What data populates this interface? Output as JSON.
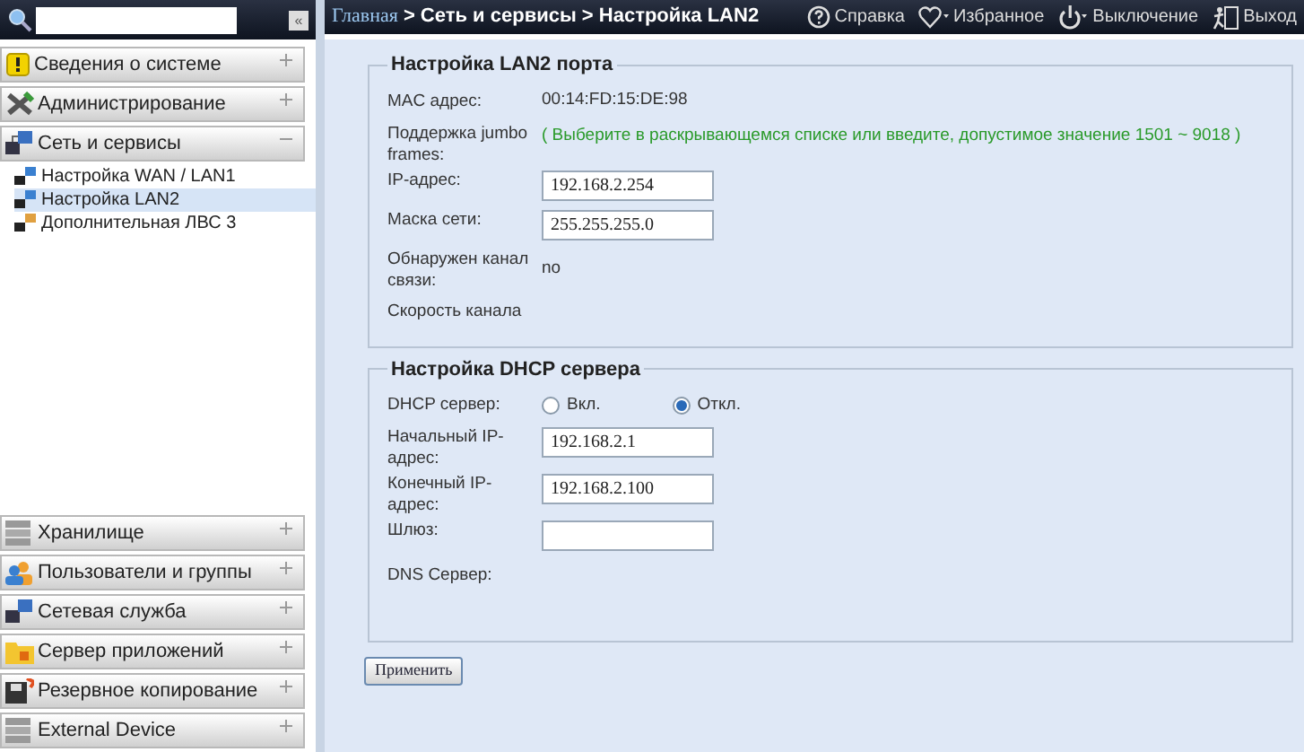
{
  "sidebar": {
    "collapse_label": "«",
    "groups_top": [
      {
        "label": "Сведения о системе",
        "expanded": false
      },
      {
        "label": "Администрирование",
        "expanded": false
      },
      {
        "label": "Сеть и сервисы",
        "expanded": true,
        "children": [
          {
            "label": "Настройка WAN / LAN1",
            "selected": false
          },
          {
            "label": "Настройка LAN2",
            "selected": true
          },
          {
            "label": "Дополнительная ЛВС 3",
            "selected": false
          }
        ]
      }
    ],
    "groups_bottom": [
      {
        "label": "Хранилище",
        "expanded": false
      },
      {
        "label": "Пользователи и группы",
        "expanded": false
      },
      {
        "label": "Сетевая служба",
        "expanded": false
      },
      {
        "label": "Сервер приложений",
        "expanded": false
      },
      {
        "label": "Резервное копирование",
        "expanded": false
      },
      {
        "label": "External Device",
        "expanded": false
      }
    ]
  },
  "header": {
    "breadcrumb_home": "Главная",
    "breadcrumb_rest": "> Сеть и сервисы > Настройка LAN2",
    "actions": [
      {
        "label": "Справка",
        "kind": "help"
      },
      {
        "label": "Избранное",
        "kind": "favorite"
      },
      {
        "label": "Выключение",
        "kind": "power"
      },
      {
        "label": "Выход",
        "kind": "logout"
      }
    ]
  },
  "lan_section": {
    "title": "Настройка LAN2 порта",
    "rows": [
      {
        "kind": "text",
        "label": "MAC адрес:",
        "value": "00:14:FD:15:DE:98"
      },
      {
        "kind": "hint",
        "label": "Поддержка jumbo frames:",
        "value": "( Выберите в раскрывающемся списке или введите, допустимое значение 1501 ~ 9018 )"
      },
      {
        "kind": "input",
        "label": "IP-адрес:",
        "value": "192.168.2.254"
      },
      {
        "kind": "input",
        "label": "Маска сети:",
        "value": "255.255.255.0"
      },
      {
        "kind": "text",
        "label": "Обнаружен канал связи:",
        "value": "no"
      },
      {
        "kind": "label",
        "label": "Скорость канала"
      }
    ]
  },
  "dhcp_section": {
    "title": "Настройка DHCP сервера",
    "rows": [
      {
        "kind": "radio",
        "label": "DHCP сервер:",
        "options": [
          {
            "label": "Вкл.",
            "selected": false
          },
          {
            "label": "Откл.",
            "selected": true
          }
        ]
      },
      {
        "kind": "input",
        "label": "Начальный IP-адрес:",
        "value": "192.168.2.1"
      },
      {
        "kind": "input",
        "label": "Конечный IP-адрес:",
        "value": "192.168.2.100"
      },
      {
        "kind": "input",
        "label": "Шлюз:",
        "value": ""
      },
      {
        "kind": "label",
        "label": "DNS Сервер:"
      }
    ]
  },
  "apply_button": "Применить"
}
